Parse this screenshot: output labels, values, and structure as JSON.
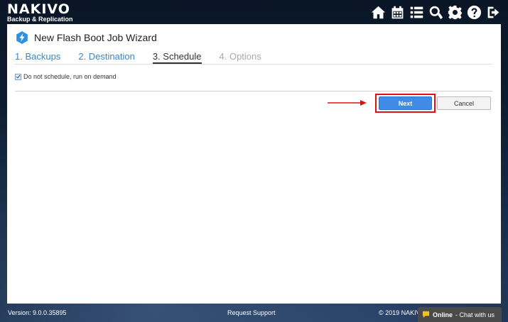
{
  "app": {
    "logo_main": "NAKIVO",
    "logo_sub": "Backup & Replication"
  },
  "topbar": {
    "icons": [
      "home-icon",
      "calendar-icon",
      "list-icon",
      "search-icon",
      "gear-icon",
      "help-icon",
      "logout-icon"
    ]
  },
  "wizard": {
    "title": "New Flash Boot Job Wizard",
    "tabs": [
      {
        "label": "1. Backups",
        "state": "link"
      },
      {
        "label": "2. Destination",
        "state": "link"
      },
      {
        "label": "3. Schedule",
        "state": "active"
      },
      {
        "label": "4. Options",
        "state": "disabled"
      }
    ],
    "schedule": {
      "checkbox_label": "Do not schedule, run on demand",
      "checked": true
    },
    "buttons": {
      "next": "Next",
      "cancel": "Cancel"
    }
  },
  "footer": {
    "version": "Version: 9.0.0.35895",
    "support": "Request Support",
    "copyright": "© 2019 NAKIV",
    "chat_status": "Online",
    "chat_text": "- Chat with us"
  },
  "colors": {
    "accent": "#3f8be8",
    "tab_link": "#3a86c8",
    "highlight": "#e01010"
  }
}
